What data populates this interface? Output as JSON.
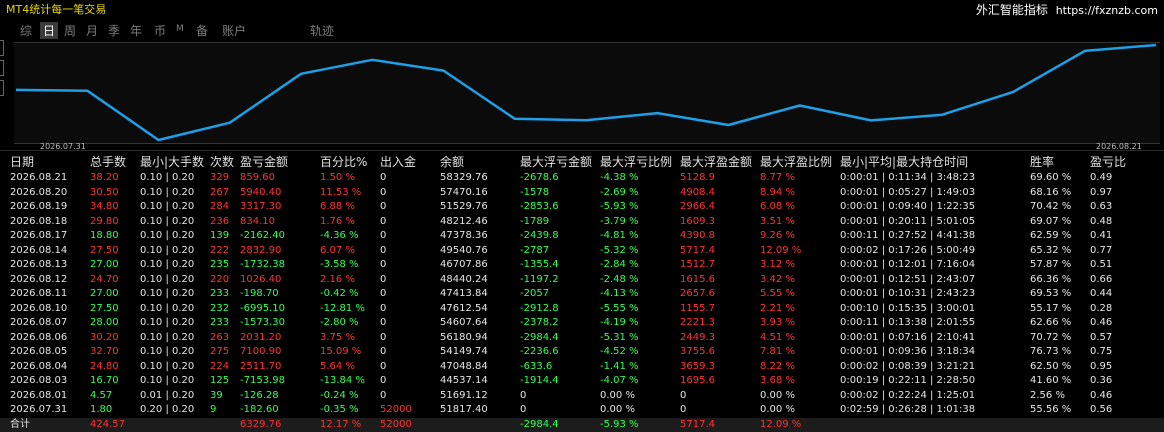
{
  "app_title": "MT4统计每一笔交易",
  "brand": {
    "name": "外汇智能指标",
    "url": "https://fxznzb.com"
  },
  "tabs": [
    {
      "label": "综",
      "active": false
    },
    {
      "label": "日",
      "active": true
    },
    {
      "label": "周",
      "active": false
    },
    {
      "label": "月",
      "active": false
    },
    {
      "label": "季",
      "active": false
    },
    {
      "label": "年",
      "active": false
    },
    {
      "label": "币",
      "active": false
    },
    {
      "label": "M",
      "active": false
    },
    {
      "label": "备",
      "active": false
    },
    {
      "label": "账户",
      "active": false
    },
    {
      "label": "轨迹",
      "active": false
    }
  ],
  "colors": {
    "line": "#1e9fe6",
    "profit": "#ff3333",
    "loss": "#33ff55",
    "background": "#000000"
  },
  "chart_data": {
    "type": "line",
    "x": [
      "2026.07.31",
      "2026.08.01",
      "2026.08.03",
      "2026.08.04",
      "2026.08.05",
      "2026.08.06",
      "2026.08.07",
      "2026.08.10",
      "2026.08.11",
      "2026.08.12",
      "2026.08.13",
      "2026.08.14",
      "2026.08.17",
      "2026.08.18",
      "2026.08.19",
      "2026.08.20",
      "2026.08.21"
    ],
    "values": [
      51817.4,
      51691.12,
      44537.14,
      47048.84,
      54149.74,
      56180.94,
      54607.64,
      47612.54,
      47413.84,
      48440.24,
      46707.86,
      49540.76,
      47378.36,
      48212.46,
      51529.76,
      57470.16,
      58329.76
    ],
    "x_start_label": "2026.07.31",
    "x_end_label": "2026.08.21",
    "grid": false
  },
  "table": {
    "headers": [
      "日期",
      "总手数",
      "最小|大手数",
      "次数",
      "盈亏金额",
      "百分比%",
      "出入金",
      "余额",
      "最大浮亏金额",
      "最大浮亏比例",
      "最大浮盈金额",
      "最大浮盈比例",
      "最小|平均|最大持仓时间",
      "胜率",
      "盈亏比"
    ],
    "rows": [
      [
        "2026.08.21",
        "38.20",
        "0.10 | 0.20",
        "329",
        "859.60",
        "1.50 %",
        "0",
        "58329.76",
        "-2678.6",
        "-4.38 %",
        "5128.9",
        "8.77 %",
        "0:00:01 | 0:11:34 | 3:48:23",
        "69.60 %",
        "0.49"
      ],
      [
        "2026.08.20",
        "30.50",
        "0.10 | 0.20",
        "267",
        "5940.40",
        "11.53 %",
        "0",
        "57470.16",
        "-1578",
        "-2.69 %",
        "4908.4",
        "8.94 %",
        "0:00:01 | 0:05:27 | 1:49:03",
        "68.16 %",
        "0.97"
      ],
      [
        "2026.08.19",
        "34.80",
        "0.10 | 0.20",
        "284",
        "3317.30",
        "6.88 %",
        "0",
        "51529.76",
        "-2853.6",
        "-5.93 %",
        "2966.4",
        "6.08 %",
        "0:00:01 | 0:09:40 | 1:22:35",
        "70.42 %",
        "0.63"
      ],
      [
        "2026.08.18",
        "29.80",
        "0.10 | 0.20",
        "236",
        "834.10",
        "1.76 %",
        "0",
        "48212.46",
        "-1789",
        "-3.79 %",
        "1609.3",
        "3.51 %",
        "0:00:01 | 0:20:11 | 5:01:05",
        "69.07 %",
        "0.48"
      ],
      [
        "2026.08.17",
        "18.80",
        "0.10 | 0.20",
        "139",
        "-2162.40",
        "-4.36 %",
        "0",
        "47378.36",
        "-2439.8",
        "-4.81 %",
        "4390.8",
        "9.26 %",
        "0:00:11 | 0:27:52 | 4:41:38",
        "62.59 %",
        "0.41"
      ],
      [
        "2026.08.14",
        "27.50",
        "0.10 | 0.20",
        "222",
        "2832.90",
        "6.07 %",
        "0",
        "49540.76",
        "-2787",
        "-5.32 %",
        "5717.4",
        "12.09 %",
        "0:00:02 | 0:17:26 | 5:00:49",
        "65.32 %",
        "0.77"
      ],
      [
        "2026.08.13",
        "27.00",
        "0.10 | 0.20",
        "235",
        "-1732.38",
        "-3.58 %",
        "0",
        "46707.86",
        "-1355.4",
        "-2.84 %",
        "1512.7",
        "3.12 %",
        "0:00:01 | 0:12:01 | 7:16:04",
        "57.87 %",
        "0.51"
      ],
      [
        "2026.08.12",
        "24.70",
        "0.10 | 0.20",
        "220",
        "1026.40",
        "2.16 %",
        "0",
        "48440.24",
        "-1197.2",
        "-2.48 %",
        "1615.6",
        "3.42 %",
        "0:00:01 | 0:12:51 | 2:43:07",
        "66.36 %",
        "0.66"
      ],
      [
        "2026.08.11",
        "27.00",
        "0.10 | 0.20",
        "233",
        "-198.70",
        "-0.42 %",
        "0",
        "47413.84",
        "-2057",
        "-4.13 %",
        "2657.6",
        "5.55 %",
        "0:00:01 | 0:10:31 | 2:43:23",
        "69.53 %",
        "0.44"
      ],
      [
        "2026.08.10",
        "27.50",
        "0.10 | 0.20",
        "232",
        "-6995.10",
        "-12.81 %",
        "0",
        "47612.54",
        "-2912.8",
        "-5.55 %",
        "1155.7",
        "2.21 %",
        "0:00:10 | 0:15:35 | 3:00:01",
        "55.17 %",
        "0.28"
      ],
      [
        "2026.08.07",
        "28.00",
        "0.10 | 0.20",
        "233",
        "-1573.30",
        "-2.80 %",
        "0",
        "54607.64",
        "-2378.2",
        "-4.19 %",
        "2221.3",
        "3.93 %",
        "0:00:11 | 0:13:38 | 2:01:55",
        "62.66 %",
        "0.46"
      ],
      [
        "2026.08.06",
        "30.20",
        "0.10 | 0.20",
        "263",
        "2031.20",
        "3.75 %",
        "0",
        "56180.94",
        "-2984.4",
        "-5.31 %",
        "2449.3",
        "4.51 %",
        "0:00:01 | 0:07:16 | 2:10:41",
        "70.72 %",
        "0.57"
      ],
      [
        "2026.08.05",
        "32.70",
        "0.10 | 0.20",
        "275",
        "7100.90",
        "15.09 %",
        "0",
        "54149.74",
        "-2236.6",
        "-4.52 %",
        "3755.6",
        "7.81 %",
        "0:00:01 | 0:09:36 | 3:18:34",
        "76.73 %",
        "0.75"
      ],
      [
        "2026.08.04",
        "24.80",
        "0.10 | 0.20",
        "224",
        "2511.70",
        "5.64 %",
        "0",
        "47048.84",
        "-633.6",
        "-1.41 %",
        "3659.3",
        "8.22 %",
        "0:00:02 | 0:08:39 | 3:21:21",
        "62.50 %",
        "0.95"
      ],
      [
        "2026.08.03",
        "16.70",
        "0.10 | 0.20",
        "125",
        "-7153.98",
        "-13.84 %",
        "0",
        "44537.14",
        "-1914.4",
        "-4.07 %",
        "1695.6",
        "3.68 %",
        "0:00:19 | 0:22:11 | 2:28:50",
        "41.60 %",
        "0.36"
      ],
      [
        "2026.08.01",
        "4.57",
        "0.01 | 0.20",
        "39",
        "-126.28",
        "-0.24 %",
        "0",
        "51691.12",
        "0",
        "0.00 %",
        "0",
        "0.00 %",
        "0:00:02 | 0:22:24 | 1:25:01",
        "2.56 %",
        "0.46"
      ],
      [
        "2026.07.31",
        "1.80",
        "0.20 | 0.20",
        "9",
        "-182.60",
        "-0.35 %",
        "52000",
        "51817.40",
        "0",
        "0.00 %",
        "0",
        "0.00 %",
        "0:02:59 | 0:26:28 | 1:01:38",
        "55.56 %",
        "0.56"
      ]
    ],
    "total": [
      "合计",
      "424.57",
      "",
      "",
      "6329.76",
      "12.17 %",
      "52000",
      "",
      "-2984.4",
      "-5.93 %",
      "5717.4",
      "12.09 %",
      "",
      "",
      ""
    ]
  }
}
